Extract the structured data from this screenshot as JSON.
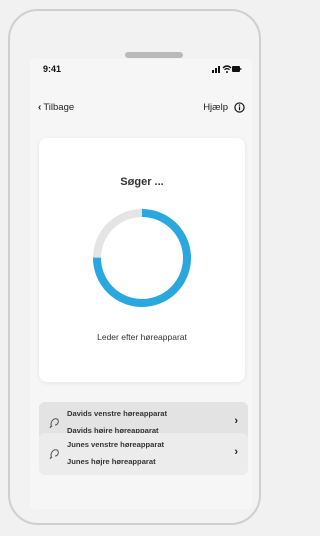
{
  "status_bar": {
    "time": "9:41"
  },
  "nav": {
    "back_label": "Tilbage",
    "help_label": "Hjælp"
  },
  "search_card": {
    "title": "Søger ...",
    "caption": "Leder efter høreapparat",
    "progress_fraction": 0.75,
    "progress_color": "#29a7df",
    "track_color": "#e4e4e4"
  },
  "device_groups": [
    {
      "lines": [
        "Davids venstre høreapparat",
        "Davids højre høreapparat"
      ]
    },
    {
      "lines": [
        "Junes venstre høreapparat",
        "Junes højre høreapparat"
      ]
    }
  ],
  "icons": {
    "back": "chevron-left-icon",
    "help": "info-circle-icon",
    "device": "hearing-aid-icon",
    "row": "chevron-right-icon"
  }
}
